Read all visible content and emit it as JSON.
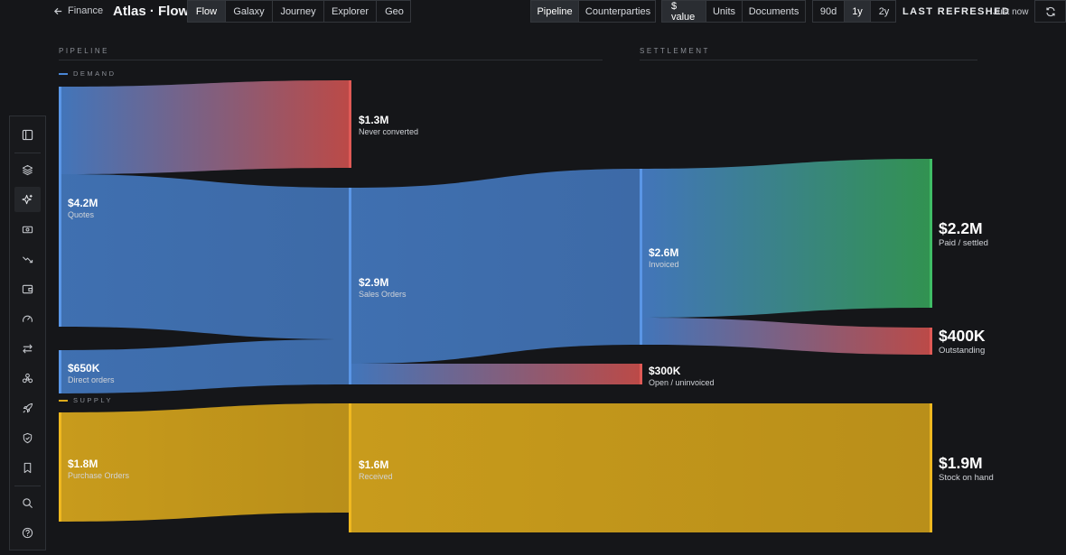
{
  "header": {
    "back_label": "Finance",
    "app_title": "Atlas · Flow",
    "view_tabs": [
      "Flow",
      "Galaxy",
      "Journey",
      "Explorer",
      "Geo"
    ],
    "active_view": "Flow",
    "mode_tabs": [
      "Pipeline",
      "Counterparties"
    ],
    "active_mode": "Pipeline",
    "measure_tabs": [
      "$ value",
      "Units",
      "Documents"
    ],
    "active_measure": "$ value",
    "range_tabs": [
      "90d",
      "1y",
      "2y"
    ],
    "active_range": "1y",
    "refreshed_label": "LAST REFRESHED",
    "refreshed_value": "Just now"
  },
  "sidebar": {
    "icons": [
      "panel-toggle-icon",
      "layers-icon",
      "sparkle-icon",
      "cash-icon",
      "trend-down-icon",
      "wallet-icon",
      "gauge-icon",
      "transfer-icon",
      "network-icon",
      "rocket-icon",
      "shield-icon",
      "bookmark-icon",
      "search-icon",
      "help-icon"
    ],
    "active_icon": "sparkle-icon"
  },
  "sections": {
    "pipeline": "PIPELINE",
    "settlement": "SETTLEMENT",
    "demand": "DEMAND",
    "supply": "SUPPLY"
  },
  "colors": {
    "blue": "#4a86d6",
    "red": "#d9534f",
    "green": "#37a85a",
    "gold": "#dcaa1c"
  },
  "nodes": {
    "quotes": {
      "value": "$4.2M",
      "name": "Quotes"
    },
    "direct": {
      "value": "$650K",
      "name": "Direct orders"
    },
    "never": {
      "value": "$1.3M",
      "name": "Never converted"
    },
    "sales": {
      "value": "$2.9M",
      "name": "Sales Orders"
    },
    "invoiced": {
      "value": "$2.6M",
      "name": "Invoiced"
    },
    "open": {
      "value": "$300K",
      "name": "Open / uninvoiced"
    },
    "paid": {
      "value": "$2.2M",
      "name": "Paid / settled"
    },
    "outstanding": {
      "value": "$400K",
      "name": "Outstanding"
    },
    "po": {
      "value": "$1.8M",
      "name": "Purchase Orders"
    },
    "received": {
      "value": "$1.6M",
      "name": "Received"
    },
    "stock": {
      "value": "$1.9M",
      "name": "Stock on hand"
    }
  }
}
